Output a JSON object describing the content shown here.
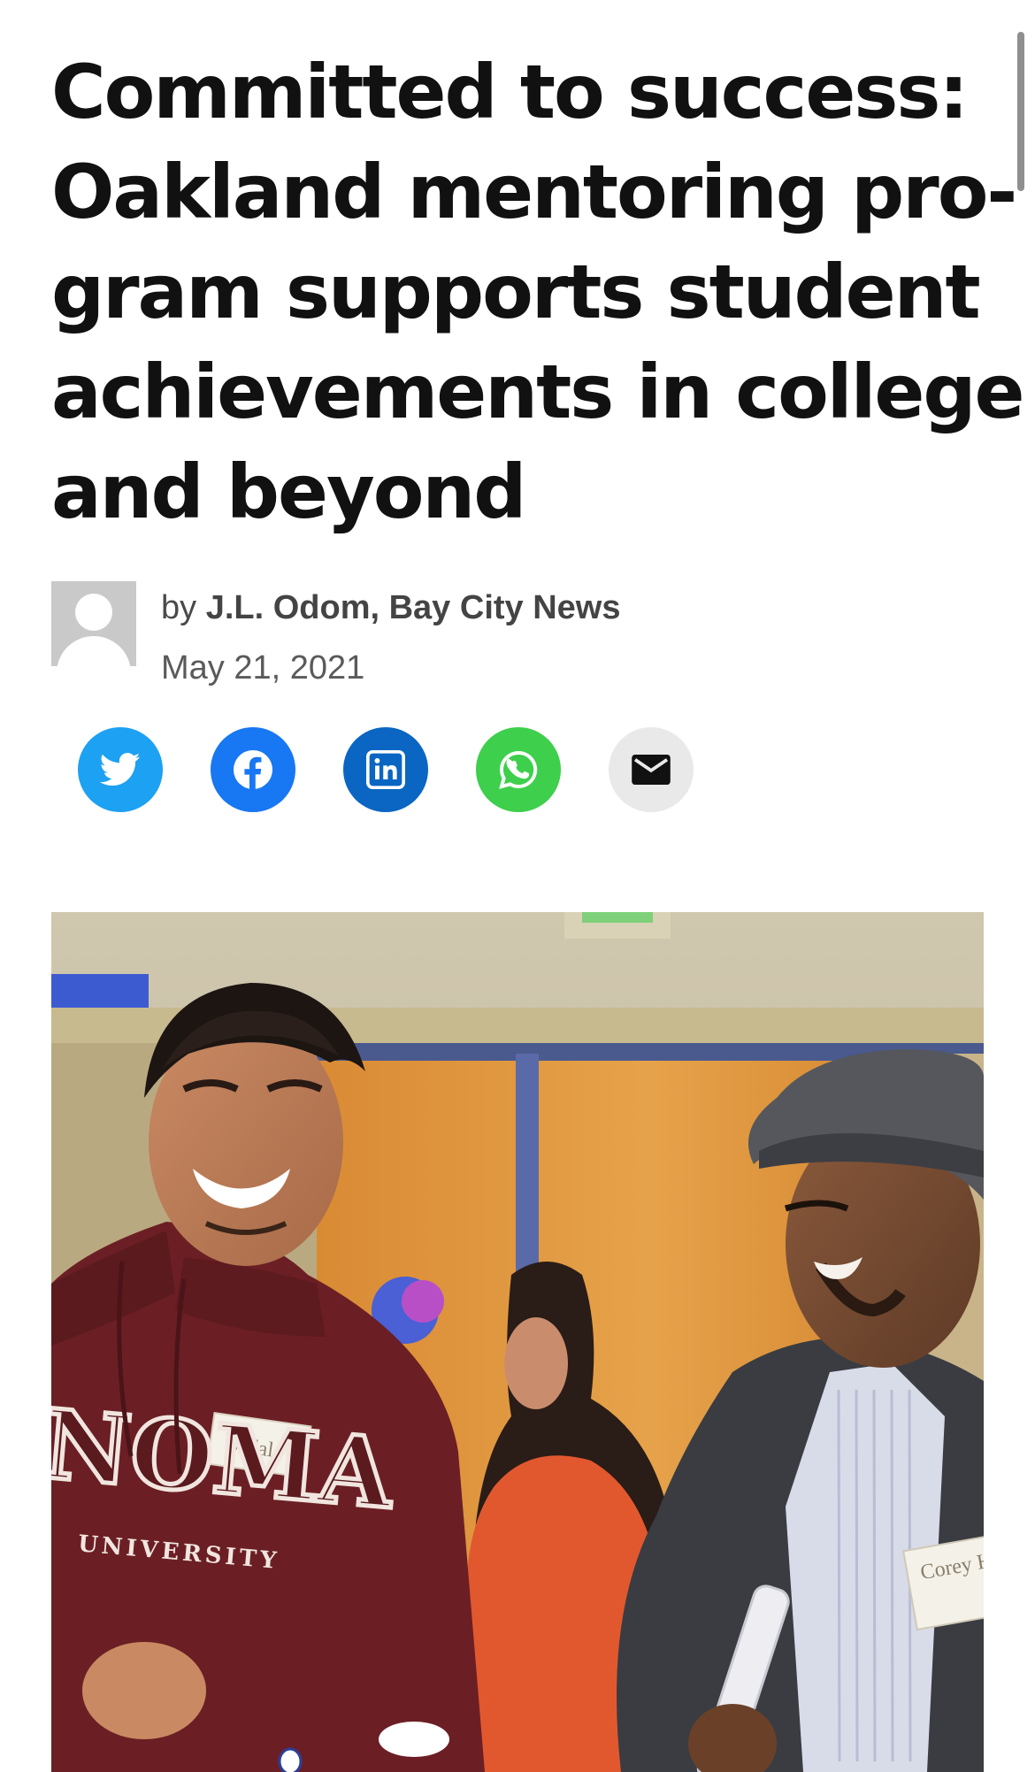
{
  "article": {
    "headline_lines": [
      "Committed to success:",
      "Oakland mentoring pro-",
      "gram supports student",
      "achievements in college",
      "and beyond"
    ],
    "byline_prefix": "by",
    "author": "J.L. Odom, Bay City News",
    "date": "May 21, 2021"
  },
  "share_buttons": [
    {
      "name": "twitter",
      "color": "#1da1f2",
      "icon": "twitter-icon"
    },
    {
      "name": "facebook",
      "color": "#1877f2",
      "icon": "facebook-icon"
    },
    {
      "name": "linkedin",
      "color": "#0a66c2",
      "icon": "linkedin-icon"
    },
    {
      "name": "whatsapp",
      "color": "#3ecf4c",
      "icon": "whatsapp-icon"
    },
    {
      "name": "email",
      "color": "#e9e9e9",
      "icon": "email-icon"
    }
  ],
  "photo": {
    "name_tags": [
      "Vidal",
      "Corey Hill"
    ],
    "sweatshirt_text": "NOMA",
    "sweatshirt_subtext": "UNIVERSITY"
  }
}
